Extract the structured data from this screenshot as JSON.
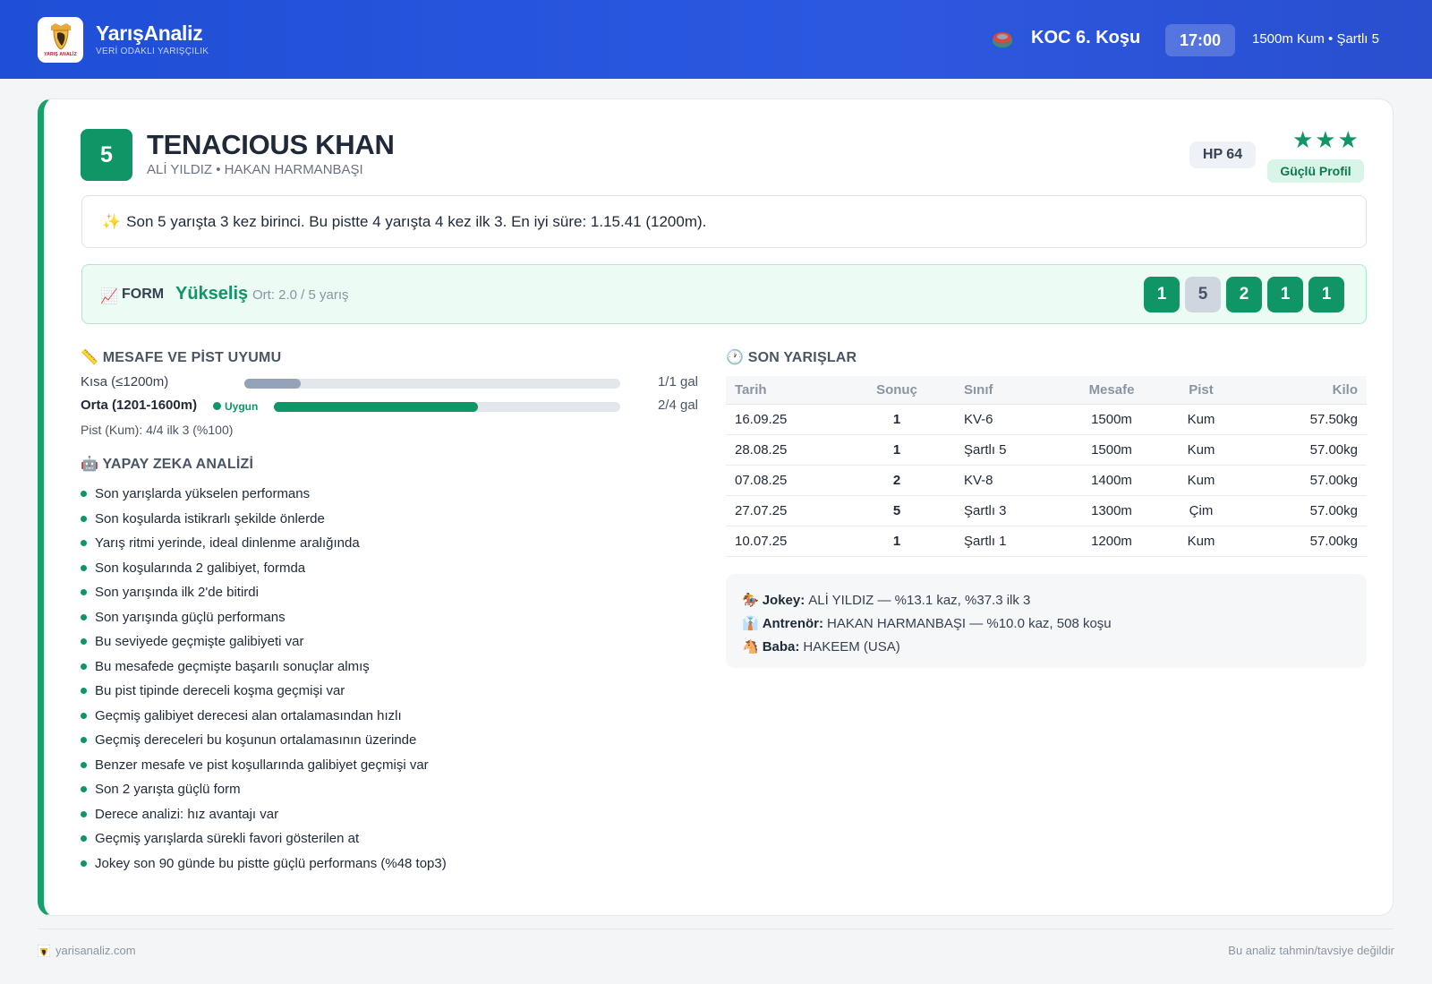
{
  "header": {
    "brand_title": "YarışAnaliz",
    "brand_subtitle": "VERİ ODAKLI YARIŞÇILIK",
    "logo_text": "YARIŞ ANALİZ",
    "race_name": "KOC 6. Koşu",
    "race_time": "17:00",
    "race_meta": "1500m Kum • Şartlı 5"
  },
  "horse": {
    "number": "5",
    "name": "TENACIOUS KHAN",
    "connections": "ALİ YILDIZ • HAKAN HARMANBAŞI",
    "hp": "HP 64",
    "stars": "★★★",
    "star_count": 3,
    "profile": "Güçlü Profil"
  },
  "summary": {
    "icon": "✨",
    "text": "Son 5 yarışta 3 kez birinci. Bu pistte 4 yarışta 4 kez ilk 3. En iyi süre: 1.15.41 (1200m)."
  },
  "form": {
    "icon": "📈",
    "label": "FORM",
    "trend": "Yükseliş",
    "average": "Ort: 2.0 / 5 yarış",
    "results": [
      "1",
      "5",
      "2",
      "1",
      "1"
    ]
  },
  "distance": {
    "title": "📏 MESAFE VE PİST UYUMU",
    "rows": [
      {
        "label": "Kısa (≤1200m)",
        "value": "1/1 gal",
        "fraction": 0.15,
        "color": "#94a3b8",
        "fit": ""
      },
      {
        "label": "Orta (1201-1600m)",
        "value": "2/4 gal",
        "fraction": 0.59,
        "color": "#109566",
        "fit": "Uygun"
      }
    ],
    "pist": "Pist (Kum): 4/4 ilk 3 (%100)"
  },
  "ai": {
    "title": "🤖 YAPAY ZEKA ANALİZİ",
    "items": [
      "Son yarışlarda yükselen performans",
      "Son koşularda istikrarlı şekilde önlerde",
      "Yarış ritmi yerinde, ideal dinlenme aralığında",
      "Son koşularında 2 galibiyet, formda",
      "Son yarışında ilk 2'de bitirdi",
      "Son yarışında güçlü performans",
      "Bu seviyede geçmişte galibiyeti var",
      "Bu mesafede geçmişte başarılı sonuçlar almış",
      "Bu pist tipinde dereceli koşma geçmişi var",
      "Geçmiş galibiyet derecesi alan ortalamasından hızlı",
      "Geçmiş dereceleri bu koşunun ortalamasının üzerinde",
      "Benzer mesafe ve pist koşullarında galibiyet geçmişi var",
      "Son 2 yarışta güçlü form",
      "Derece analizi: hız avantajı var",
      "Geçmiş yarışlarda sürekli favori gösterilen at",
      "Jokey son 90 günde bu pistte güçlü performans (%48 top3)"
    ]
  },
  "recent": {
    "title": "🕐 SON YARIŞLAR",
    "columns": [
      "Tarih",
      "Sonuç",
      "Sınıf",
      "Mesafe",
      "Pist",
      "Kilo"
    ],
    "rows": [
      [
        "16.09.25",
        "1",
        "KV-6",
        "1500m",
        "Kum",
        "57.50kg"
      ],
      [
        "28.08.25",
        "1",
        "Şartlı 5",
        "1500m",
        "Kum",
        "57.00kg"
      ],
      [
        "07.08.25",
        "2",
        "KV-8",
        "1400m",
        "Kum",
        "57.00kg"
      ],
      [
        "27.07.25",
        "5",
        "Şartlı 3",
        "1300m",
        "Çim",
        "57.00kg"
      ],
      [
        "10.07.25",
        "1",
        "Şartlı 1",
        "1200m",
        "Kum",
        "57.00kg"
      ]
    ]
  },
  "info": [
    {
      "icon": "🏇",
      "label": "Jokey:",
      "value": "ALİ YILDIZ — %13.1 kaz, %37.3 ilk 3"
    },
    {
      "icon": "👔",
      "label": "Antrenör:",
      "value": "HAKAN HARMANBAŞI — %10.0 kaz, 508 koşu"
    },
    {
      "icon": "🐴",
      "label": "Baba:",
      "value": "HAKEEM (USA)"
    }
  ],
  "footer": {
    "site": "yarisanaliz.com",
    "disclaimer": "Bu analiz tahmin/tavsiye değildir"
  },
  "colors": {
    "header": "#2c58e0",
    "accent_green": "#109566",
    "second_place": "#d97706"
  }
}
